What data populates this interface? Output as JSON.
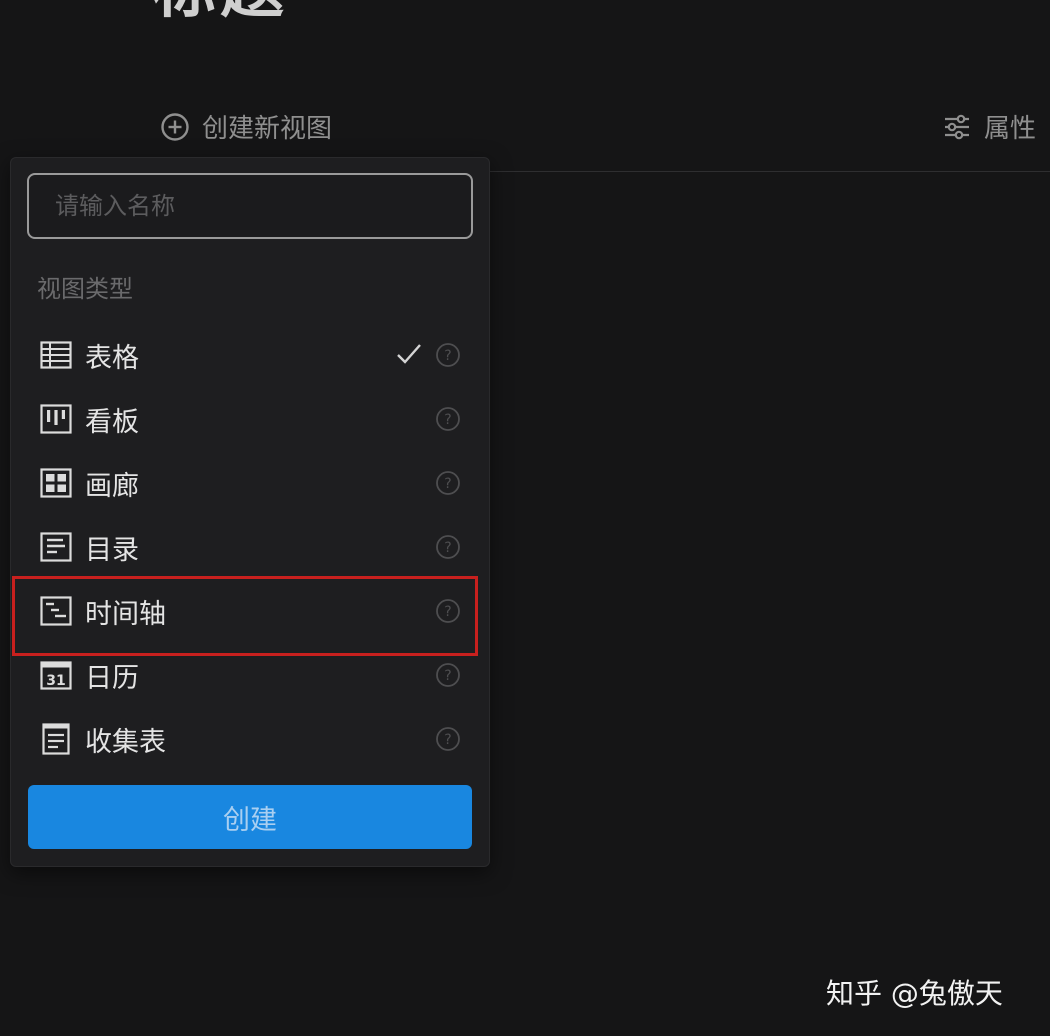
{
  "page": {
    "title": "标题"
  },
  "toolbar": {
    "create_view_label": "创建新视图",
    "properties_label": "属性"
  },
  "popover": {
    "name_input": {
      "value": "",
      "placeholder": "请输入名称"
    },
    "section_label": "视图类型",
    "view_types": [
      {
        "label": "表格",
        "icon": "table-icon",
        "selected": true
      },
      {
        "label": "看板",
        "icon": "kanban-icon",
        "selected": false
      },
      {
        "label": "画廊",
        "icon": "gallery-icon",
        "selected": false
      },
      {
        "label": "目录",
        "icon": "list-icon",
        "selected": false
      },
      {
        "label": "时间轴",
        "icon": "timeline-icon",
        "selected": false,
        "highlighted": true
      },
      {
        "label": "日历",
        "icon": "calendar-icon",
        "selected": false
      },
      {
        "label": "收集表",
        "icon": "form-icon",
        "selected": false
      }
    ],
    "calendar_icon_text": "31",
    "create_button_label": "创建"
  },
  "watermark": {
    "text": "知乎 @兔傲天"
  },
  "colors": {
    "background": "#151516",
    "popover": "#1e1e20",
    "primary_button": "#1987e0",
    "highlight_border": "#c8201e"
  }
}
